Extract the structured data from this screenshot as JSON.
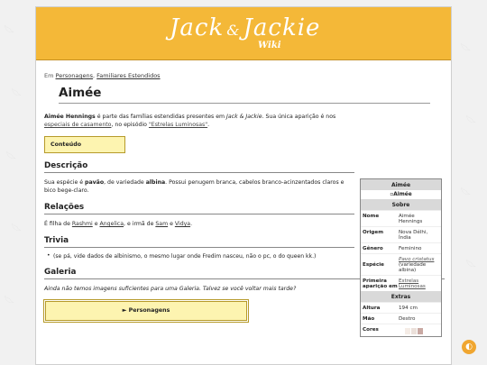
{
  "logo": {
    "main": "Jack",
    "amp": "&",
    "second": "Jackie",
    "sub": "Wiki"
  },
  "breadcrumb": {
    "prefix": "Em",
    "link1": "Personagens",
    "sep": ", ",
    "link2": "Familiares Estendidos"
  },
  "page_title": "Aimée",
  "intro": {
    "name": "Aimée Hennings",
    "t1": " é parte das famílias estendidas presentes em ",
    "show": "Jack & Jackie",
    "t2": ". Sua única aparição é nos ",
    "link1": "especiais de casamento",
    "t3": ", no episódio ",
    "link2": "\"Estrelas Luminosas\"",
    "t4": "."
  },
  "toc_label": "Conteúdo",
  "sections": {
    "descricao": {
      "title": "Descrição",
      "t1": "Sua espécie é ",
      "b1": "pavão",
      "t2": ", de variedade ",
      "b2": "albina",
      "t3": ". Possui penugem branca, cabelos branco-acinzentados claros e bico bege-claro."
    },
    "relacoes": {
      "title": "Relações",
      "t1": "É filha de ",
      "l1": "Rashmi",
      "t2": " e ",
      "l2": "Angelica",
      "t3": ", e irmã de ",
      "l3": "Sam",
      "t4": " e ",
      "l4": "Vidya",
      "t5": "."
    },
    "trivia": {
      "title": "Trivia",
      "item": "(se pá, vide dados de albinismo, o mesmo lugar onde Fredim nasceu, não o pc, o do queen kk.)"
    },
    "galeria": {
      "title": "Galeria",
      "text": "Ainda não temos imagens suficientes para uma Galeria. Talvez se você voltar mais tarde?"
    }
  },
  "nav_box": {
    "arrow": "►",
    "label": "Personagens"
  },
  "infobox": {
    "title": "Aimée",
    "image_alt": "Aimée",
    "about_header": "Sobre",
    "rows": [
      {
        "k": "Nome",
        "v": "Aimée Hennings"
      },
      {
        "k": "Origem",
        "v": "Nova Délhi, Índia"
      },
      {
        "k": "Gênero",
        "v": "Feminino"
      }
    ],
    "especie": {
      "k": "Espécie",
      "sci": "Pavo cristatus",
      "v": "(variedade albina)"
    },
    "primeira": {
      "k": "Primeira aparição em",
      "v": "Estrelas Luminosas"
    },
    "extras_header": "Extras",
    "extras": [
      {
        "k": "Altura",
        "v": "194 cm"
      },
      {
        "k": "Mão",
        "v": "Destro"
      }
    ],
    "cores_label": "Cores",
    "colors": [
      "#ffffff",
      "#f5ece6",
      "#ebe0da",
      "#c9a9a3"
    ]
  },
  "fab_icon": "◐",
  "colors": {
    "header": "#f4b838",
    "box": "#fdf4b0",
    "box_border": "#b69a2a"
  }
}
